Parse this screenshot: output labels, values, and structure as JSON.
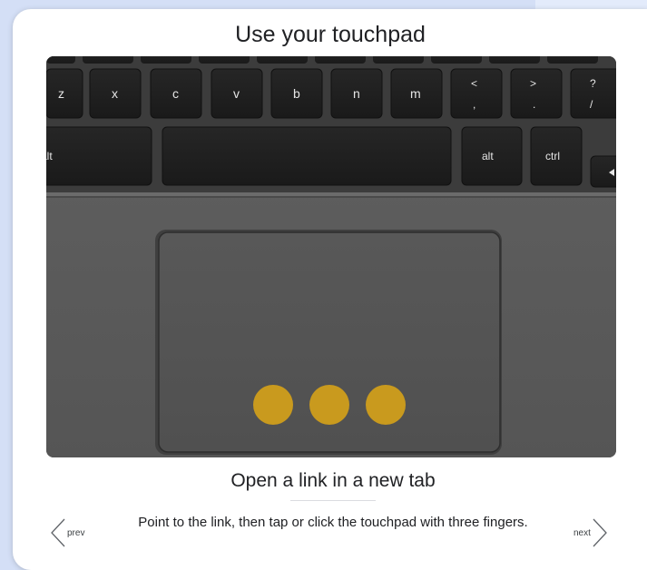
{
  "dialog": {
    "title": "Use your touchpad"
  },
  "keyboard": {
    "letter_keys": [
      "z",
      "x",
      "c",
      "v",
      "b",
      "n",
      "m"
    ],
    "punct_keys": [
      {
        "top": "<",
        "bottom": ","
      },
      {
        "top": ">",
        "bottom": "."
      },
      {
        "top": "?",
        "bottom": "/"
      }
    ],
    "left_alt": "alt",
    "right_alt": "alt",
    "ctrl": "ctrl"
  },
  "touchpad": {
    "finger_count": 3,
    "finger_color": "#c99a1e"
  },
  "step": {
    "title": "Open a link in a new tab",
    "description": "Point to the link, then tap or click the touchpad with three fingers."
  },
  "navigation": {
    "prev_label": "prev",
    "next_label": "next"
  },
  "colors": {
    "background": "#d4dff6",
    "card": "#ffffff",
    "laptop_body": "#5b5b5b",
    "key": "#1f1f1f"
  }
}
